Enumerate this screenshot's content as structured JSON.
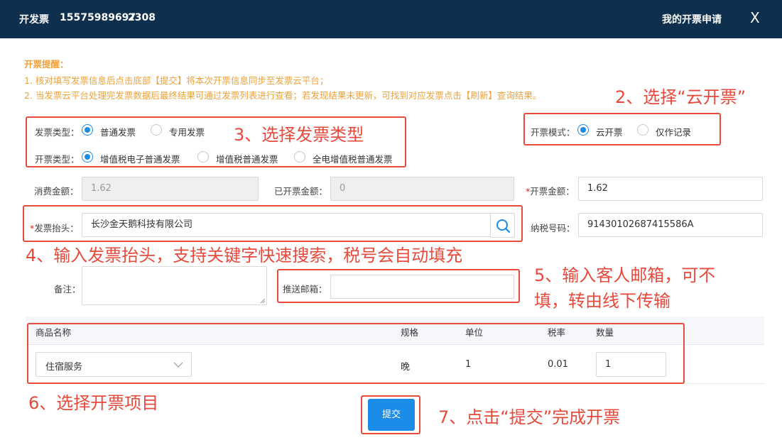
{
  "header": {
    "title": "开发票",
    "phone": "15575989697",
    "code": "2308",
    "my_apply": "我的开票申请",
    "close": "X"
  },
  "notice": {
    "head": "开票提醒：",
    "line1": "1. 核对填写发票信息后点击底部【提交】将本次开票信息同步至发票云平台；",
    "line2": "2. 当发票云平台处理完发票数据后最终结果可通过发票列表进行查看；若发现结果未更新，可找到对应发票点击【刷新】查询结果。"
  },
  "invoice_type": {
    "label": "发票类型：",
    "options": [
      "普通发票",
      "专用发票"
    ],
    "selected": "普通发票"
  },
  "billing_type": {
    "label": "开票类型：",
    "options": [
      "增值税电子普通发票",
      "增值税普通发票",
      "全电增值税普通发票"
    ],
    "selected": "增值税电子普通发票"
  },
  "billing_mode": {
    "label": "开票模式：",
    "options": [
      "云开票",
      "仅作记录"
    ],
    "selected": "云开票"
  },
  "amounts": {
    "consume_label": "消费金额：",
    "consume_value": "1.62",
    "issued_label": "已开票金额：",
    "issued_value": "0",
    "invoice_label": "开票金额：",
    "invoice_value": "1.62"
  },
  "invoice_title": {
    "label": "发票抬头：",
    "value": "长沙金天鹅科技有限公司"
  },
  "tax_no": {
    "label": "纳税号码：",
    "value": "91430102687415586A"
  },
  "remark": {
    "label": "备注："
  },
  "email": {
    "label": "推送邮箱：",
    "value": ""
  },
  "table": {
    "headers": {
      "name": "商品名称",
      "spec": "规格",
      "unit": "单位",
      "rate": "税率",
      "qty": "数量"
    },
    "row": {
      "name": "住宿服务",
      "spec": "晚",
      "unit": "1",
      "rate": "0.01",
      "qty": "1"
    }
  },
  "submit_label": "提交",
  "annotations": {
    "a2": "2、选择“云开票”",
    "a3": "3、选择发票类型",
    "a4": "4、输入发票抬头，支持关键字快速搜索，税号会自动填充",
    "a5_l1": "5、输入客人邮箱，可不",
    "a5_l2": "填，转由线下传输",
    "a6": "6、选择开票项目",
    "a7": "7、点击“提交”完成开票"
  },
  "colors": {
    "header_bg": "#0f2f4f",
    "accent": "#1b8ce8",
    "notice": "#f0a13a",
    "annotation": "#e84a3c"
  },
  "icons": [
    "close-icon",
    "search-icon",
    "chevron-down-icon"
  ]
}
